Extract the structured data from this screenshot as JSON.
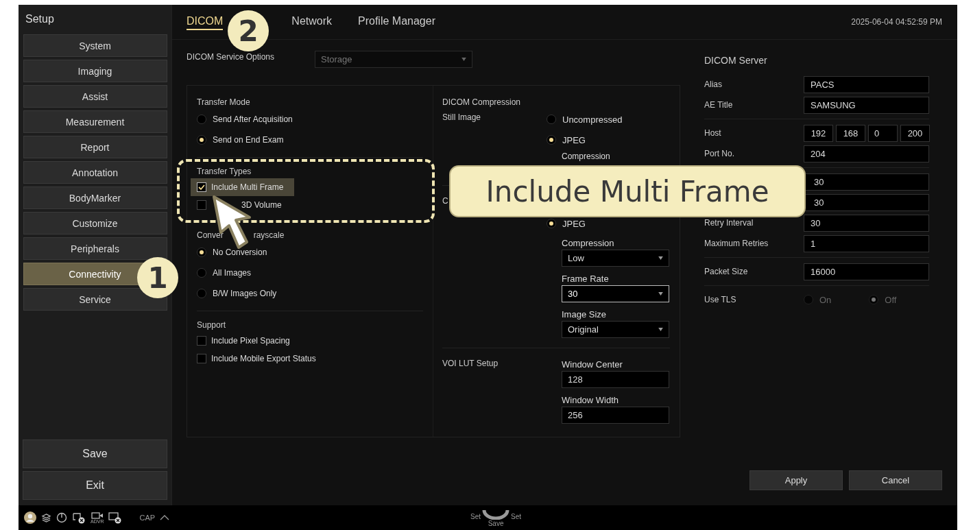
{
  "sidebar": {
    "title": "Setup",
    "items": [
      {
        "label": "System",
        "selected": false
      },
      {
        "label": "Imaging",
        "selected": false
      },
      {
        "label": "Assist",
        "selected": false
      },
      {
        "label": "Measurement",
        "selected": false
      },
      {
        "label": "Report",
        "selected": false
      },
      {
        "label": "Annotation",
        "selected": false
      },
      {
        "label": "BodyMarker",
        "selected": false
      },
      {
        "label": "Customize",
        "selected": false
      },
      {
        "label": "Peripherals",
        "selected": false
      },
      {
        "label": "Connectivity",
        "selected": true
      },
      {
        "label": "Service",
        "selected": false
      }
    ],
    "buttons": [
      "Save",
      "Exit"
    ]
  },
  "tabs": [
    {
      "label": "DICOM",
      "selected": true
    },
    {
      "label": "Network",
      "selected": false
    },
    {
      "label": "Profile Manager",
      "selected": false
    }
  ],
  "datetime": "2025-06-04 04:52:59 PM",
  "service_options": {
    "label": "DICOM Service Options",
    "value": "Storage",
    "disabled": true
  },
  "transfer_mode": {
    "title": "Transfer Mode",
    "options": [
      {
        "label": "Send After Acquisition",
        "selected": false
      },
      {
        "label": "Send on End Exam",
        "selected": true
      }
    ]
  },
  "transfer_types": {
    "title": "Transfer Types",
    "items": [
      {
        "label": "Include Multi Frame",
        "checked": true,
        "highlighted": true
      },
      {
        "label": "3D Volume",
        "checked": false,
        "highlighted": false
      }
    ]
  },
  "grayscale": {
    "title_parts": [
      "Conver",
      "rayscale"
    ],
    "options": [
      {
        "label": "No Conversion",
        "selected": true
      },
      {
        "label": "All Images",
        "selected": false
      },
      {
        "label": "B/W Images Only",
        "selected": false
      }
    ]
  },
  "support": {
    "title": "Support",
    "items": [
      {
        "label": "Include Pixel Spacing",
        "checked": false
      },
      {
        "label": "Include Mobile Export Status",
        "checked": false
      }
    ]
  },
  "compression": {
    "title": "DICOM Compression",
    "still_image": {
      "label": "Still Image",
      "options": [
        {
          "label": "Uncompressed",
          "selected": false
        },
        {
          "label": "JPEG",
          "selected": true
        }
      ],
      "sub_label": "Compression"
    },
    "cine": {
      "label": "C",
      "options": [
        {
          "label": "JPEG",
          "selected": true
        }
      ],
      "selects": [
        {
          "label": "Compression",
          "value": "Low",
          "focused": false
        },
        {
          "label": "Frame Rate",
          "value": "30",
          "focused": true
        },
        {
          "label": "Image Size",
          "value": "Original",
          "focused": false
        }
      ]
    },
    "voi": {
      "label": "VOI LUT Setup",
      "fields": [
        {
          "label": "Window Center",
          "value": "128"
        },
        {
          "label": "Window Width",
          "value": "256"
        }
      ]
    }
  },
  "server": {
    "title": "DICOM Server",
    "groups": [
      [
        {
          "label": "Alias",
          "value": "PACS"
        },
        {
          "label": "AE Title",
          "value": "SAMSUNG"
        }
      ],
      [
        {
          "label": "Host",
          "parts": [
            "192",
            "168",
            "0",
            "200"
          ]
        },
        {
          "label": "Port No.",
          "value": "204"
        }
      ],
      [
        {
          "value": "30"
        },
        {
          "value": "30"
        },
        {
          "label": "Retry Interval",
          "value": "30"
        },
        {
          "label": "Maximum Retries",
          "value": "1"
        }
      ],
      [
        {
          "label": "Packet Size",
          "value": "16000"
        }
      ]
    ],
    "tls": {
      "label": "Use TLS",
      "disabled": true,
      "options": [
        {
          "label": "On",
          "selected": false
        },
        {
          "label": "Off",
          "selected": true
        }
      ]
    }
  },
  "actions": [
    "Apply",
    "Cancel"
  ],
  "status_bar": {
    "advr": "ADVR",
    "cap": "CAP",
    "wheel": {
      "left": "Set",
      "right": "Set",
      "bottom": "Save"
    }
  },
  "callouts": [
    "1",
    "2"
  ],
  "tooltip": "Include Multi Frame"
}
